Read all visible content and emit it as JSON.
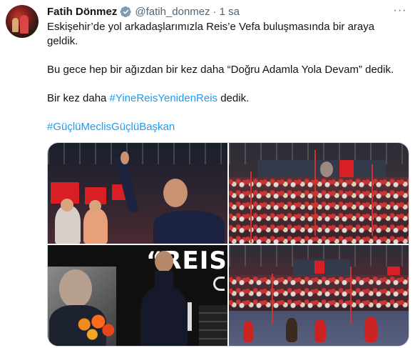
{
  "author": {
    "name": "Fatih Dönmez",
    "handle": "@fatih_donmez",
    "separator": "·",
    "time": "1 sa",
    "verified": true,
    "verified_icon": "verified-badge-icon",
    "avatar": "avatar-photo"
  },
  "more_icon": "more-options-icon",
  "more_label": "···",
  "tweet": {
    "line1": "Eskişehir’de yol arkadaşlarımızla Reis’e Vefa buluşmasında bir araya geldik.",
    "line2": "Bu gece hep bir ağızdan bir kez daha “Doğru Adamla Yola Devam” dedik.",
    "line3_prefix": "Bir kez daha ",
    "line3_hashtag": "#YineReisYenidenReis",
    "line3_suffix": " dedik.",
    "line4_hashtag": "#GüçlüMeclisGüçlüBaşkan"
  },
  "media": {
    "stage_text": "“REIS’E"
  },
  "colors": {
    "text": "#0f1419",
    "secondary": "#536471",
    "link": "#1d9bf0",
    "flag_red": "#d91f26",
    "border": "#cfd9de"
  }
}
